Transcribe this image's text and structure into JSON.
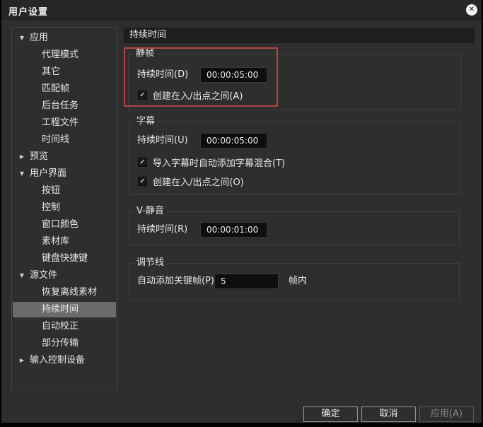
{
  "window": {
    "title": "用户设置"
  },
  "icons": {
    "close": "✕",
    "check": "✓",
    "expanded": "▼",
    "collapsed": "▶"
  },
  "sidebar": {
    "items": [
      {
        "label": "应用",
        "state": "expanded"
      },
      {
        "label": "代理模式"
      },
      {
        "label": "其它"
      },
      {
        "label": "匹配帧"
      },
      {
        "label": "后台任务"
      },
      {
        "label": "工程文件"
      },
      {
        "label": "时间线"
      },
      {
        "label": "预览",
        "state": "collapsed"
      },
      {
        "label": "用户界面",
        "state": "expanded"
      },
      {
        "label": "按钮"
      },
      {
        "label": "控制"
      },
      {
        "label": "窗口颜色"
      },
      {
        "label": "素材库"
      },
      {
        "label": "键盘快捷键"
      },
      {
        "label": "源文件",
        "state": "expanded"
      },
      {
        "label": "恢复离线素材"
      },
      {
        "label": "持续时间",
        "selected": true
      },
      {
        "label": "自动校正"
      },
      {
        "label": "部分传输"
      },
      {
        "label": "输入控制设备",
        "state": "collapsed"
      }
    ]
  },
  "main": {
    "header": "持续时间",
    "still_group": {
      "title": "静帧",
      "duration_label": "持续时间(D)",
      "duration_value": "00:00:05:00",
      "checkbox_label": "创建在入/出点之间(A)",
      "checkbox_checked": true
    },
    "subtitle_group": {
      "title": "字幕",
      "duration_label": "持续时间(U)",
      "duration_value": "00:00:05:00",
      "checkbox1_label": "导入字幕时自动添加字幕混合(T)",
      "checkbox1_checked": true,
      "checkbox2_label": "创建在入/出点之间(O)",
      "checkbox2_checked": true
    },
    "vmute_group": {
      "title": "V-静音",
      "duration_label": "持续时间(R)",
      "duration_value": "00:00:01:00"
    },
    "rubberband_group": {
      "title": "调节线",
      "keyframe_label": "自动添加关键帧(P)",
      "keyframe_value": "5",
      "keyframe_suffix": "帧内"
    }
  },
  "footer": {
    "ok": "确定",
    "cancel": "取消",
    "apply": "应用(A)"
  },
  "annotation": {
    "color": "#b54242"
  },
  "colors": {
    "dialog_bg": "#2e2e2e",
    "titlebar_bg": "#262626",
    "header_bg": "#1e1e1e",
    "selected_row_bg": "#6b6b6b",
    "input_bg": "#0e0e0e",
    "text": "#e8e8e8"
  }
}
